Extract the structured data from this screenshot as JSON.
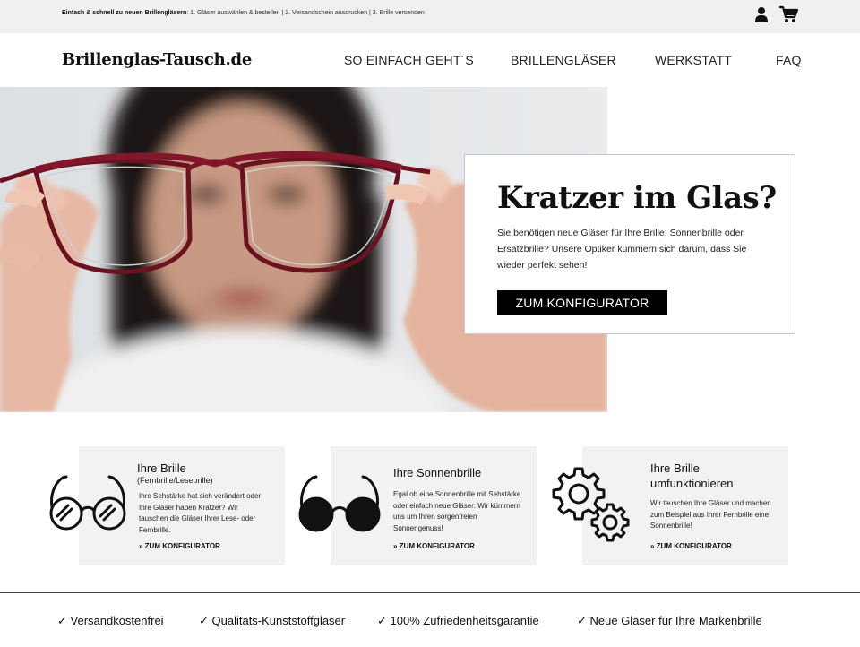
{
  "topbar": {
    "lead": "Einfach & schnell zu neuen Brillengläsern",
    "steps": ":  1. Gläser auswählen & bestellen   |   2. Versandschein ausdrucken   |   3. Brille versenden"
  },
  "header": {
    "logo": "Brillenglas-Tausch.de",
    "nav": [
      "SO EINFACH GEHT´S",
      "BRILLENGLÄSER",
      "WERKSTATT",
      "FAQ"
    ]
  },
  "hero": {
    "title": "Kratzer im Glas?",
    "text": "Sie benötigen neue Gläser für Ihre Brille, Sonnenbrille oder Ersatzbrille? Unsere Optiker kümmern sich darum, dass Sie wieder perfekt sehen!",
    "button": "ZUM KONFIGURATOR"
  },
  "tiles": [
    {
      "title": "Ihre Brille",
      "subtitle": "(Fernbrille/Lesebrille)",
      "text": "Ihre Sehstärke hat sich verändert oder Ihre Gläser haben Kratzer? Wir tauschen die Gläser Ihrer Lese- oder Fernbrille.",
      "link": "» ZUM KONFIGURATOR",
      "icon": "glasses-icon"
    },
    {
      "title": "Ihre Sonnenbrille",
      "text": "Egal ob eine Sonnenbrille mit Sehstärke oder einfach neue Gläser: Wir kümmern uns um Ihren sorgenfreien Sonnengenuss!",
      "link": "» ZUM KONFIGURATOR",
      "icon": "sunglasses-icon"
    },
    {
      "title": "Ihre Brille umfunktionieren",
      "text": "Wir tauschen Ihre Gläser und machen zum Beispiel aus Ihrer Fernbrille eine Sonnenbrille!",
      "link": "» ZUM KONFIGURATOR",
      "icon": "gears-icon"
    }
  ],
  "usps": [
    "✓ Versandkostenfrei",
    "✓ Qualitäts-Kunststoffgläser",
    "✓ 100% Zufriedenheitsgarantie",
    "✓ Neue Gläser für Ihre Markenbrille"
  ],
  "colors": {
    "button_bg": "#000000",
    "tile_bg": "#f2f2f2",
    "topbar_bg": "#f0f0f0"
  }
}
